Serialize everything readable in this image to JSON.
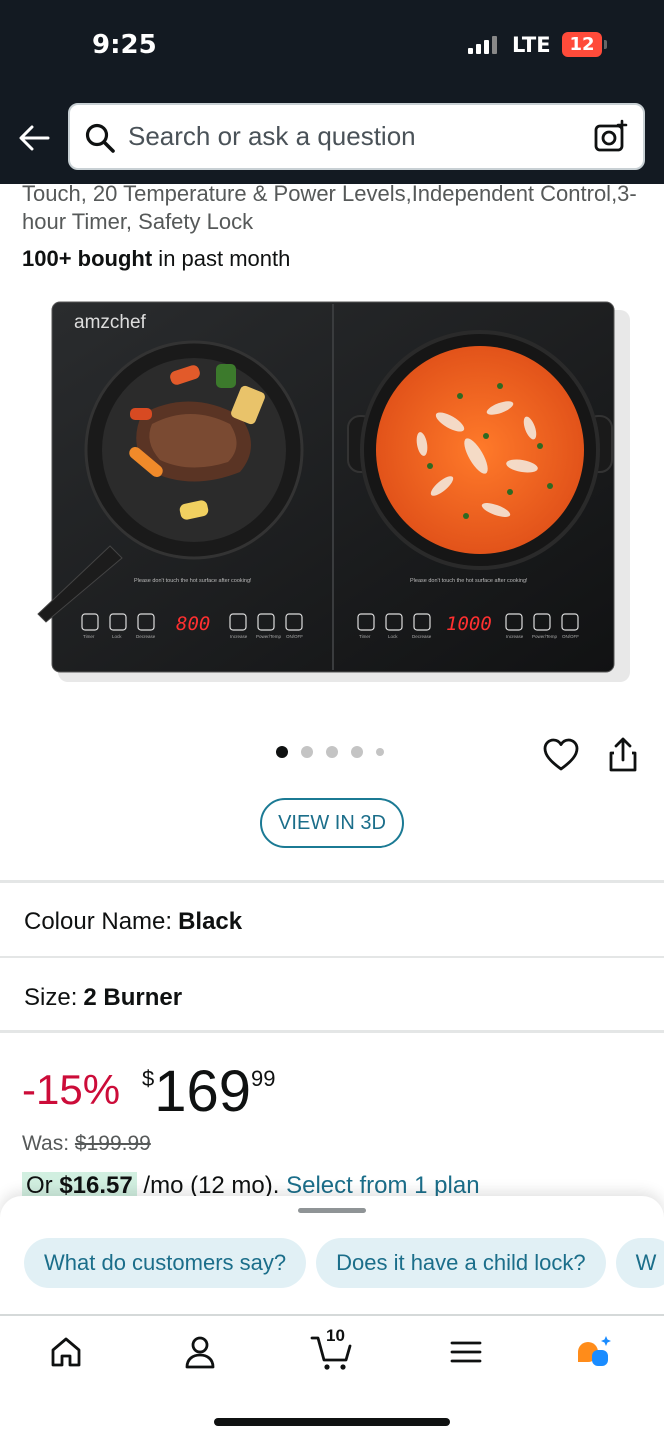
{
  "status": {
    "time": "9:25",
    "network": "LTE",
    "battery": "12"
  },
  "search": {
    "placeholder": "Search or ask a question"
  },
  "product": {
    "title_trail": "Touch, 20 Temperature & Power Levels,Independent Control,3-hour Timer, Safety Lock",
    "bought_bold": "100+ bought",
    "bought_rest": " in past month",
    "image": {
      "brand": "amzchef",
      "left_display": "800",
      "right_display": "1000",
      "warning": "Please don't touch the hot surface after cooking!",
      "labels": [
        "Timer",
        "Lock",
        "Decrease",
        "Increase",
        "Power/Temp",
        "ON/OFF"
      ]
    },
    "carousel": {
      "count": 5,
      "active": 0
    },
    "view3d_label": "VIEW IN 3D"
  },
  "options": {
    "colour_label": "Colour Name:",
    "colour_value": "Black",
    "size_label": "Size:",
    "size_value": "2 Burner"
  },
  "pricing": {
    "discount": "-15%",
    "currency": "$",
    "whole": "169",
    "fraction": "99",
    "was_label": "Was:",
    "was_value": "$199.99",
    "monthly_prefix": "Or ",
    "monthly_amount": "$16.57",
    "monthly_rest": " /mo (12 mo). ",
    "monthly_link": "Select from 1 plan"
  },
  "assistant": {
    "chips": [
      "What do customers say?",
      "Does it have a child lock?",
      "W"
    ]
  },
  "tabbar": {
    "cart_count": "10"
  },
  "colors": {
    "header_bg": "#131a22",
    "discount_red": "#cc0c39",
    "link_teal": "#1b6e8a",
    "chip_bg": "#e1f0f5",
    "rufus_orange": "#ff8c1a",
    "rufus_blue": "#1a8cff"
  },
  "icons": {
    "back": "arrow-left-icon",
    "search": "magnifier-icon",
    "camera": "camera-lens-icon",
    "heart": "heart-icon",
    "share": "share-icon",
    "home": "home-icon",
    "account": "person-icon",
    "cart": "cart-icon",
    "menu": "hamburger-icon",
    "rufus": "rufus-icon"
  }
}
